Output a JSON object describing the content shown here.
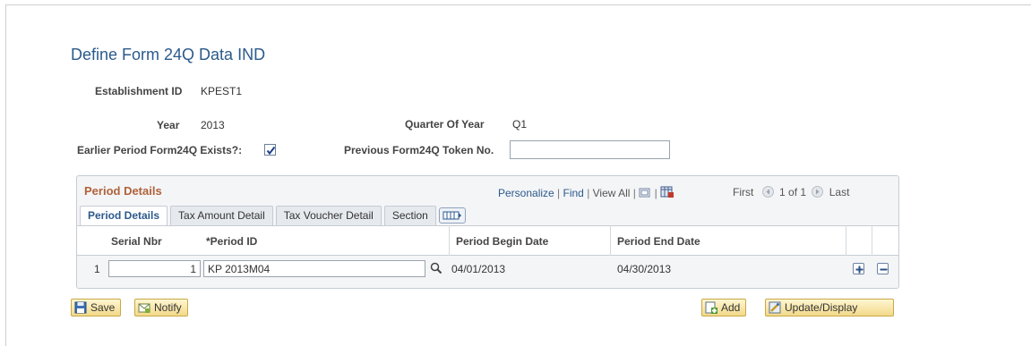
{
  "page": {
    "title": "Define Form 24Q Data IND"
  },
  "form": {
    "establishment_label": "Establishment ID",
    "establishment_value": "KPEST1",
    "year_label": "Year",
    "year_value": "2013",
    "quarter_label": "Quarter Of Year",
    "quarter_value": "Q1",
    "earlier_label": "Earlier Period Form24Q Exists?:",
    "earlier_checked": true,
    "previous_token_label": "Previous Form24Q Token No.",
    "previous_token_value": ""
  },
  "grid": {
    "title": "Period Details",
    "nav": {
      "personalize": "Personalize",
      "find": "Find",
      "view_all": "View All",
      "first": "First",
      "page_info": "1 of 1",
      "last": "Last"
    },
    "tabs": [
      {
        "label": "Period Details",
        "active": true
      },
      {
        "label": "Tax Amount Detail",
        "active": false
      },
      {
        "label": "Tax Voucher Detail",
        "active": false
      },
      {
        "label": "Section",
        "active": false
      }
    ],
    "columns": [
      "Serial Nbr",
      "*Period ID",
      "Period Begin Date",
      "Period End Date"
    ],
    "rows": [
      {
        "row_number": "1",
        "serial_nbr": "1",
        "period_id": "KP 2013M04",
        "begin_date": "04/01/2013",
        "end_date": "04/30/2013"
      }
    ]
  },
  "buttons": {
    "save": "Save",
    "notify": "Notify",
    "add": "Add",
    "update_display": "Update/Display"
  },
  "colors": {
    "title_blue": "#2b5a8c",
    "grid_title_orange": "#b0623a",
    "button_gold": "#f2d98a"
  }
}
